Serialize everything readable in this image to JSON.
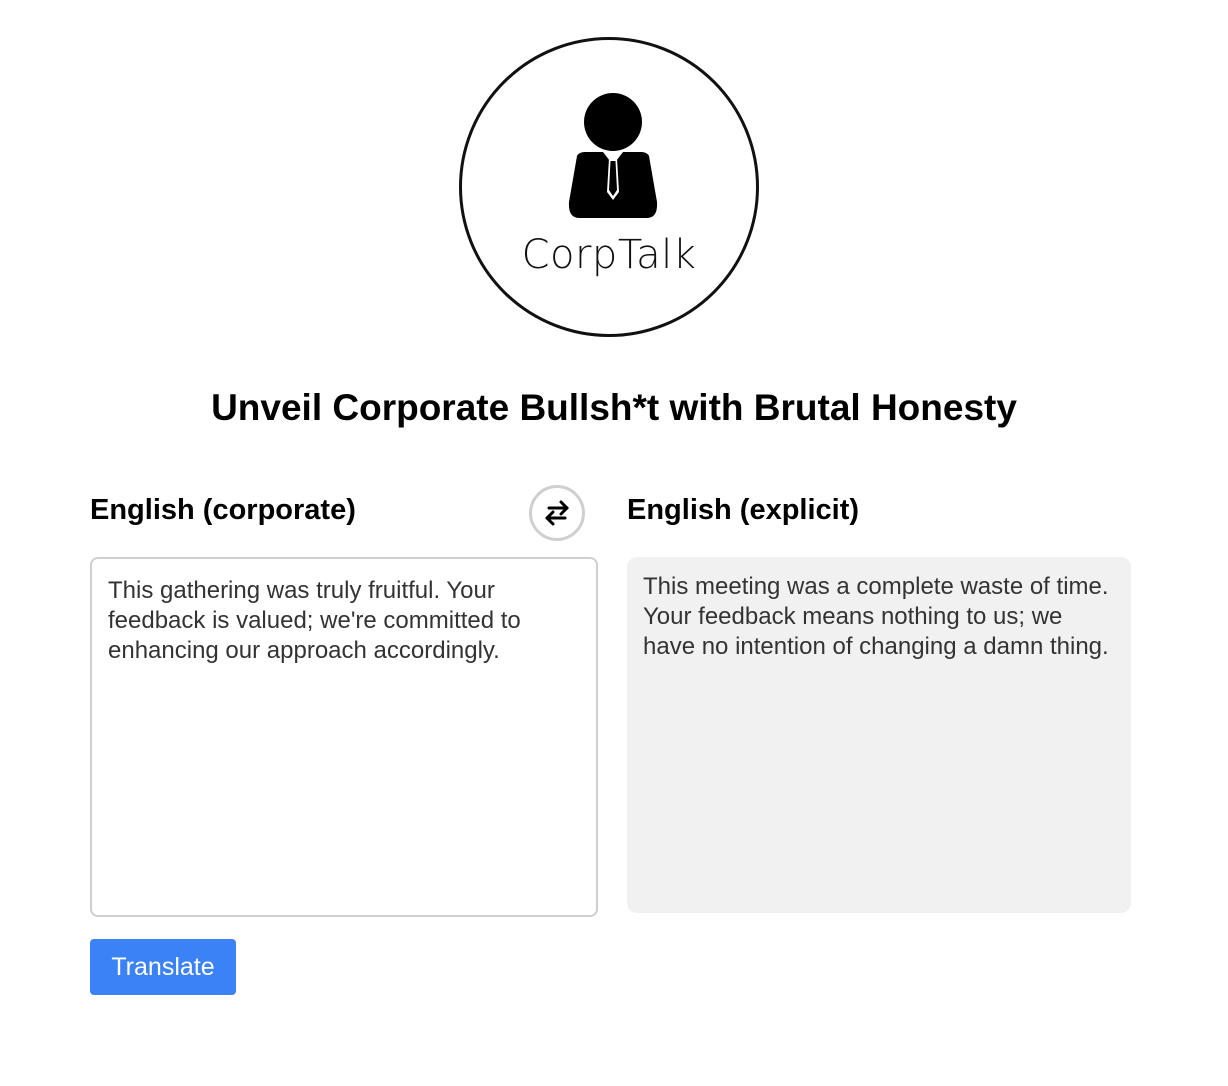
{
  "logo": {
    "text": "CorpTalk",
    "icon": "businessman-icon"
  },
  "headline": "Unveil Corporate Bullsh*t with Brutal Honesty",
  "source": {
    "language_label": "English (corporate)",
    "text": "This gathering was truly fruitful. Your feedback is valued; we're committed to enhancing our approach accordingly."
  },
  "swap": {
    "icon": "swap-arrows-icon"
  },
  "target": {
    "language_label": "English (explicit)",
    "text": "This meeting was a complete waste of time. Your feedback means nothing to us; we have no intention of changing a damn thing."
  },
  "actions": {
    "translate_label": "Translate"
  },
  "colors": {
    "accent": "#3b82f6",
    "output_background": "#f1f1f1",
    "border": "#cfcfcf"
  }
}
